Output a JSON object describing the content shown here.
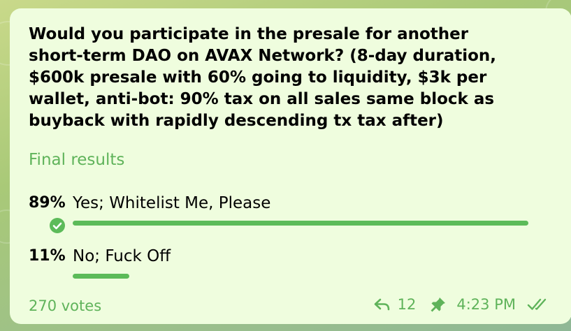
{
  "message": {
    "question": "Would you participate in the presale for another short-term DAO on AVAX Network? (8-day duration, $600k presale with 60% going to liquidity, $3k per wallet, anti-bot: 90% tax on all sales same block as buyback with rapidly descending tx tax after)",
    "poll_type": "Final results",
    "options": [
      {
        "percent": "89%",
        "label": "Yes; Whitelist Me, Please",
        "share": 0.89,
        "chosen": true
      },
      {
        "percent": "11%",
        "label": "No; Fuck Off",
        "share": 0.11,
        "chosen": false
      }
    ],
    "votes": "270 votes",
    "forward_count": "12",
    "time": "4:23 PM",
    "icons": {
      "forward": "forward-icon",
      "pin": "pin-icon",
      "read": "double-check-icon",
      "chosen": "check-circle-icon"
    },
    "colors": {
      "bubble": "#effdde",
      "accent": "#5cbb59",
      "meta_text": "#5fb35a"
    }
  }
}
